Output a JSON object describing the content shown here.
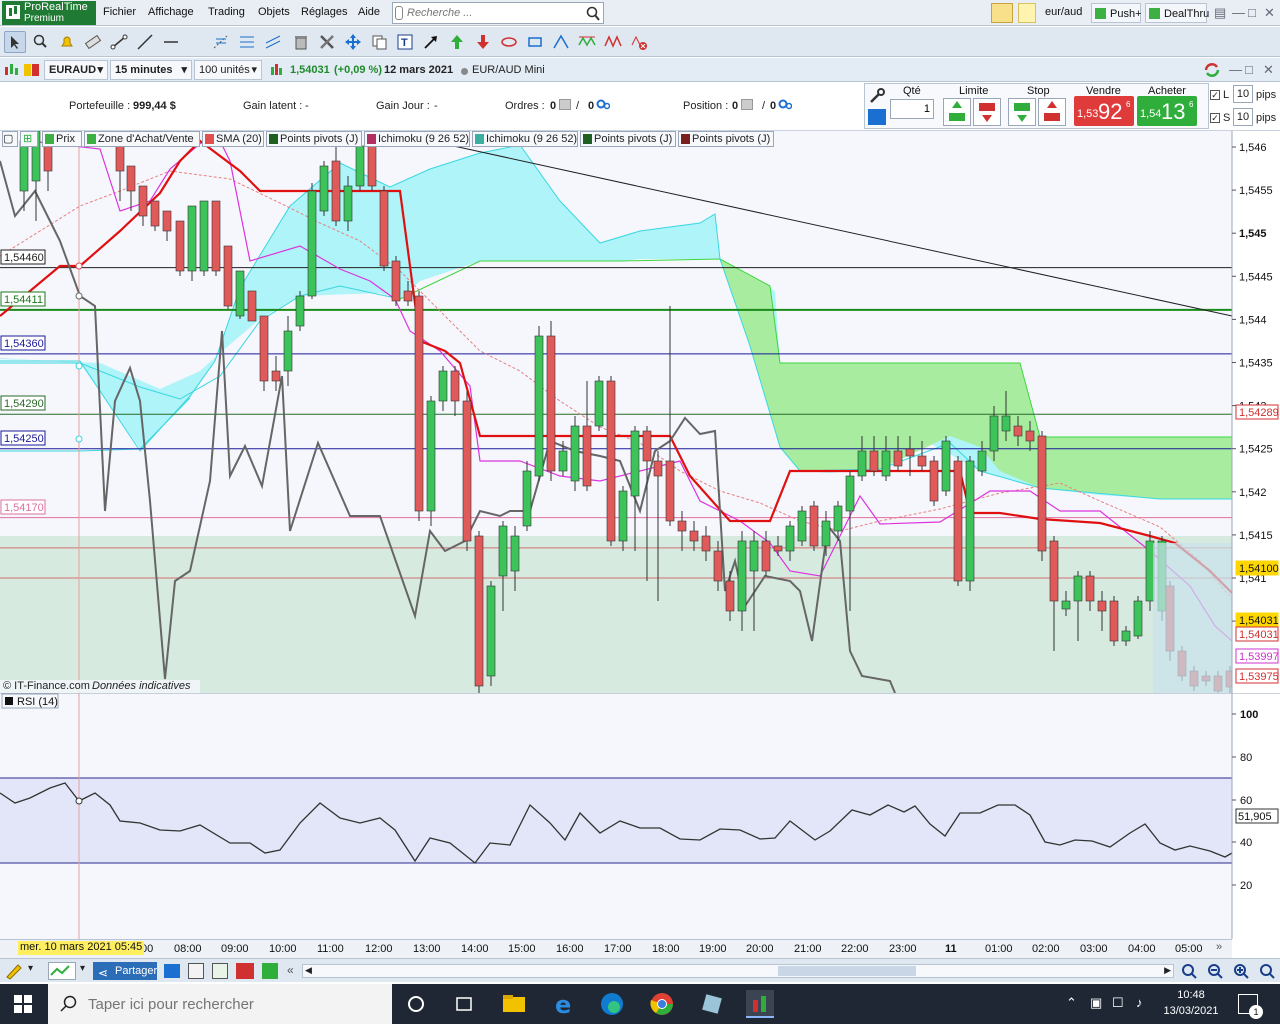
{
  "app": {
    "logo_line1": "ProRealTime",
    "logo_line2": "Premium",
    "menu": [
      "Fichier",
      "Affichage",
      "Trading",
      "Objets",
      "Réglages",
      "Aide"
    ],
    "search_placeholder": "Recherche ...",
    "symbol_quick": "eur/aud",
    "push_label": "Push+",
    "dealthru_label": "DealThru"
  },
  "chart_header": {
    "symbol": "EURAUD",
    "interval": "15 minutes",
    "units": "100 unités",
    "last_price": "1,54031",
    "change": "(+0,09 %)",
    "date": "12 mars 2021",
    "instrument": "EUR/AUD Mini"
  },
  "portfolio": {
    "portefeuille_label": "Portefeuille :",
    "portefeuille_value": "999,44 $",
    "gain_latent_label": "Gain latent :",
    "gain_latent_value": "-",
    "gain_jour_label": "Gain Jour :",
    "gain_jour_value": "-",
    "ordres_label": "Ordres :",
    "ordres_value1": "0",
    "ordres_value2": "0",
    "position_label": "Position :",
    "position_value1": "0",
    "position_value2": "0"
  },
  "order_ticket": {
    "qty_label": "Qté",
    "qty_value": "1",
    "limit_label": "Limite",
    "stop_label": "Stop",
    "sell_label": "Vendre",
    "buy_label": "Acheter",
    "sell_small": "1,53",
    "sell_big": "92",
    "sell_sup": "6",
    "buy_small": "1,54",
    "buy_big": "13",
    "buy_sup": "6",
    "l_label": "L",
    "s_label": "S",
    "l_pips": "10",
    "s_pips": "10",
    "pips_label": "pips"
  },
  "legend": {
    "items": [
      {
        "label": "Prix",
        "color": "#3cb043"
      },
      {
        "label": "Zone d'Achat/Vente",
        "color": "#3cb043"
      },
      {
        "label": "SMA (20)",
        "color": "#e05050"
      },
      {
        "label": "Points pivots (J)",
        "color": "#1f5f1f"
      },
      {
        "label": "Ichimoku (9 26 52)",
        "color": "#b03060"
      },
      {
        "label": "Ichimoku (9 26 52)",
        "color": "#3cb0a0"
      },
      {
        "label": "Points pivots (J)",
        "color": "#1f5f1f"
      },
      {
        "label": "Points pivots (J)",
        "color": "#7a1f1f"
      }
    ]
  },
  "price_axis": {
    "ticks": [
      "1,546",
      "1,5455",
      "1,545",
      "1,5445",
      "1,544",
      "1,5435",
      "1,543",
      "1,5425",
      "1,542",
      "1,5415",
      "1,541",
      "1,5405"
    ],
    "badges": [
      {
        "text": "1,54289",
        "color": "#d03030"
      },
      {
        "text": "1,54100",
        "color": "#ffd700"
      },
      {
        "text": "1,54031",
        "color": "#ffd700"
      },
      {
        "text": "1,54031",
        "color": "#d03030"
      },
      {
        "text": "1,53997",
        "color": "#cc33cc"
      },
      {
        "text": "1,53975",
        "color": "#d03030"
      }
    ]
  },
  "pivot_labels": [
    {
      "text": "1,54460",
      "color": "#222222"
    },
    {
      "text": "1,54411",
      "color": "#1a7a1a"
    },
    {
      "text": "1,54360",
      "color": "#1a1a9a"
    },
    {
      "text": "1,54290",
      "color": "#2a6a2a"
    },
    {
      "text": "1,54250",
      "color": "#1a1a9a"
    },
    {
      "text": "1,54170",
      "color": "#e070a0"
    }
  ],
  "credit": {
    "source": "© IT-Finance.com",
    "note": "Données indicatives"
  },
  "rsi": {
    "label": "RSI (14)",
    "axis_ticks": [
      "100",
      "80",
      "60",
      "40",
      "20"
    ],
    "current": "51,905"
  },
  "time_axis": {
    "cursor_label": "mer. 10 mars 2021 05:45",
    "ticks": [
      "00",
      "08:00",
      "09:00",
      "10:00",
      "11:00",
      "12:00",
      "13:00",
      "14:00",
      "15:00",
      "16:00",
      "17:00",
      "18:00",
      "19:00",
      "20:00",
      "21:00",
      "22:00",
      "23:00",
      "11",
      "01:00",
      "02:00",
      "03:00",
      "04:00",
      "05:00"
    ]
  },
  "bottom": {
    "share_label": "Partager"
  },
  "taskbar": {
    "search_placeholder": "Taper ici pour rechercher",
    "time": "10:48",
    "date": "13/03/2021",
    "notif_count": "1"
  }
}
